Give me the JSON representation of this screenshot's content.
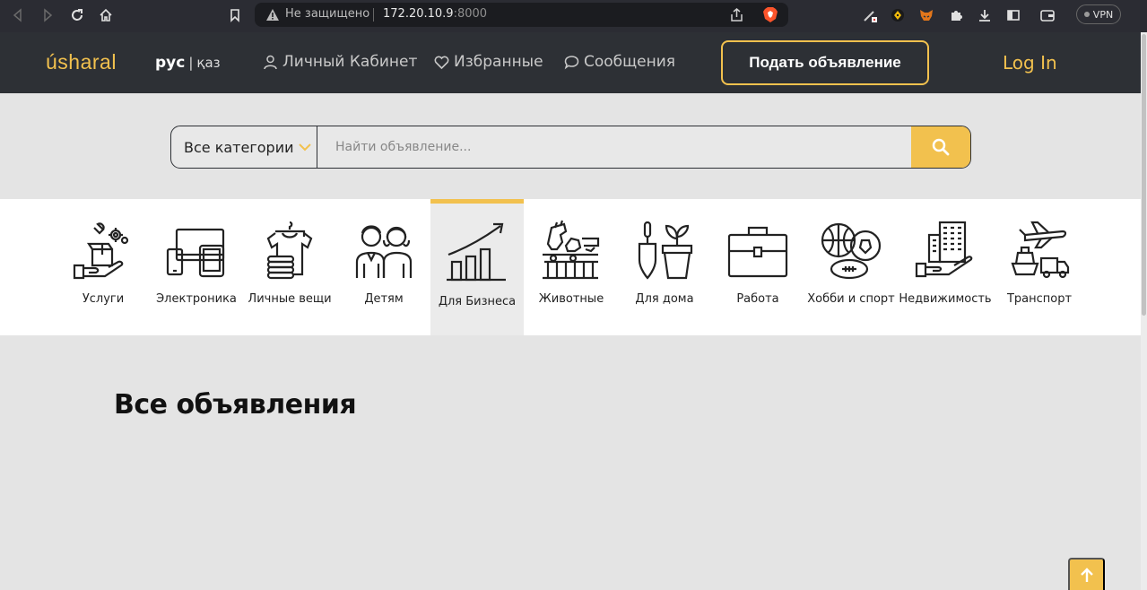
{
  "browser": {
    "security_label": "Не защищено",
    "url_host": "172.20.10.9",
    "url_port": ":8000",
    "vpn_label": "VPN"
  },
  "header": {
    "logo": "úsharal",
    "lang_active": "рус",
    "lang_other": "қаз",
    "nav": [
      {
        "label": "Личный Кабинет",
        "icon": "user-icon"
      },
      {
        "label": "Избранные",
        "icon": "heart-icon"
      },
      {
        "label": "Сообщения",
        "icon": "message-icon"
      }
    ],
    "post_button": "Подать объявление",
    "login": "Log In"
  },
  "search": {
    "category_label": "Все категории",
    "placeholder": "Найти объявление..."
  },
  "categories": [
    {
      "label": "Услуги",
      "icon": "services-icon"
    },
    {
      "label": "Электроника",
      "icon": "electronics-icon"
    },
    {
      "label": "Личные вещи",
      "icon": "clothing-icon"
    },
    {
      "label": "Детям",
      "icon": "kids-icon"
    },
    {
      "label": "Для Бизнеса",
      "icon": "business-chart-icon",
      "active": true
    },
    {
      "label": "Животные",
      "icon": "animals-icon"
    },
    {
      "label": "Для дома",
      "icon": "home-garden-icon"
    },
    {
      "label": "Работа",
      "icon": "briefcase-icon"
    },
    {
      "label": "Хобби и спорт",
      "icon": "sports-balls-icon"
    },
    {
      "label": "Недвижимость",
      "icon": "real-estate-icon"
    },
    {
      "label": "Транспорт",
      "icon": "transport-icon"
    }
  ],
  "main": {
    "title": "Все объявления"
  },
  "colors": {
    "accent": "#f2c14e",
    "header_bg": "#2d3035",
    "page_bg": "#e4e4e4"
  }
}
